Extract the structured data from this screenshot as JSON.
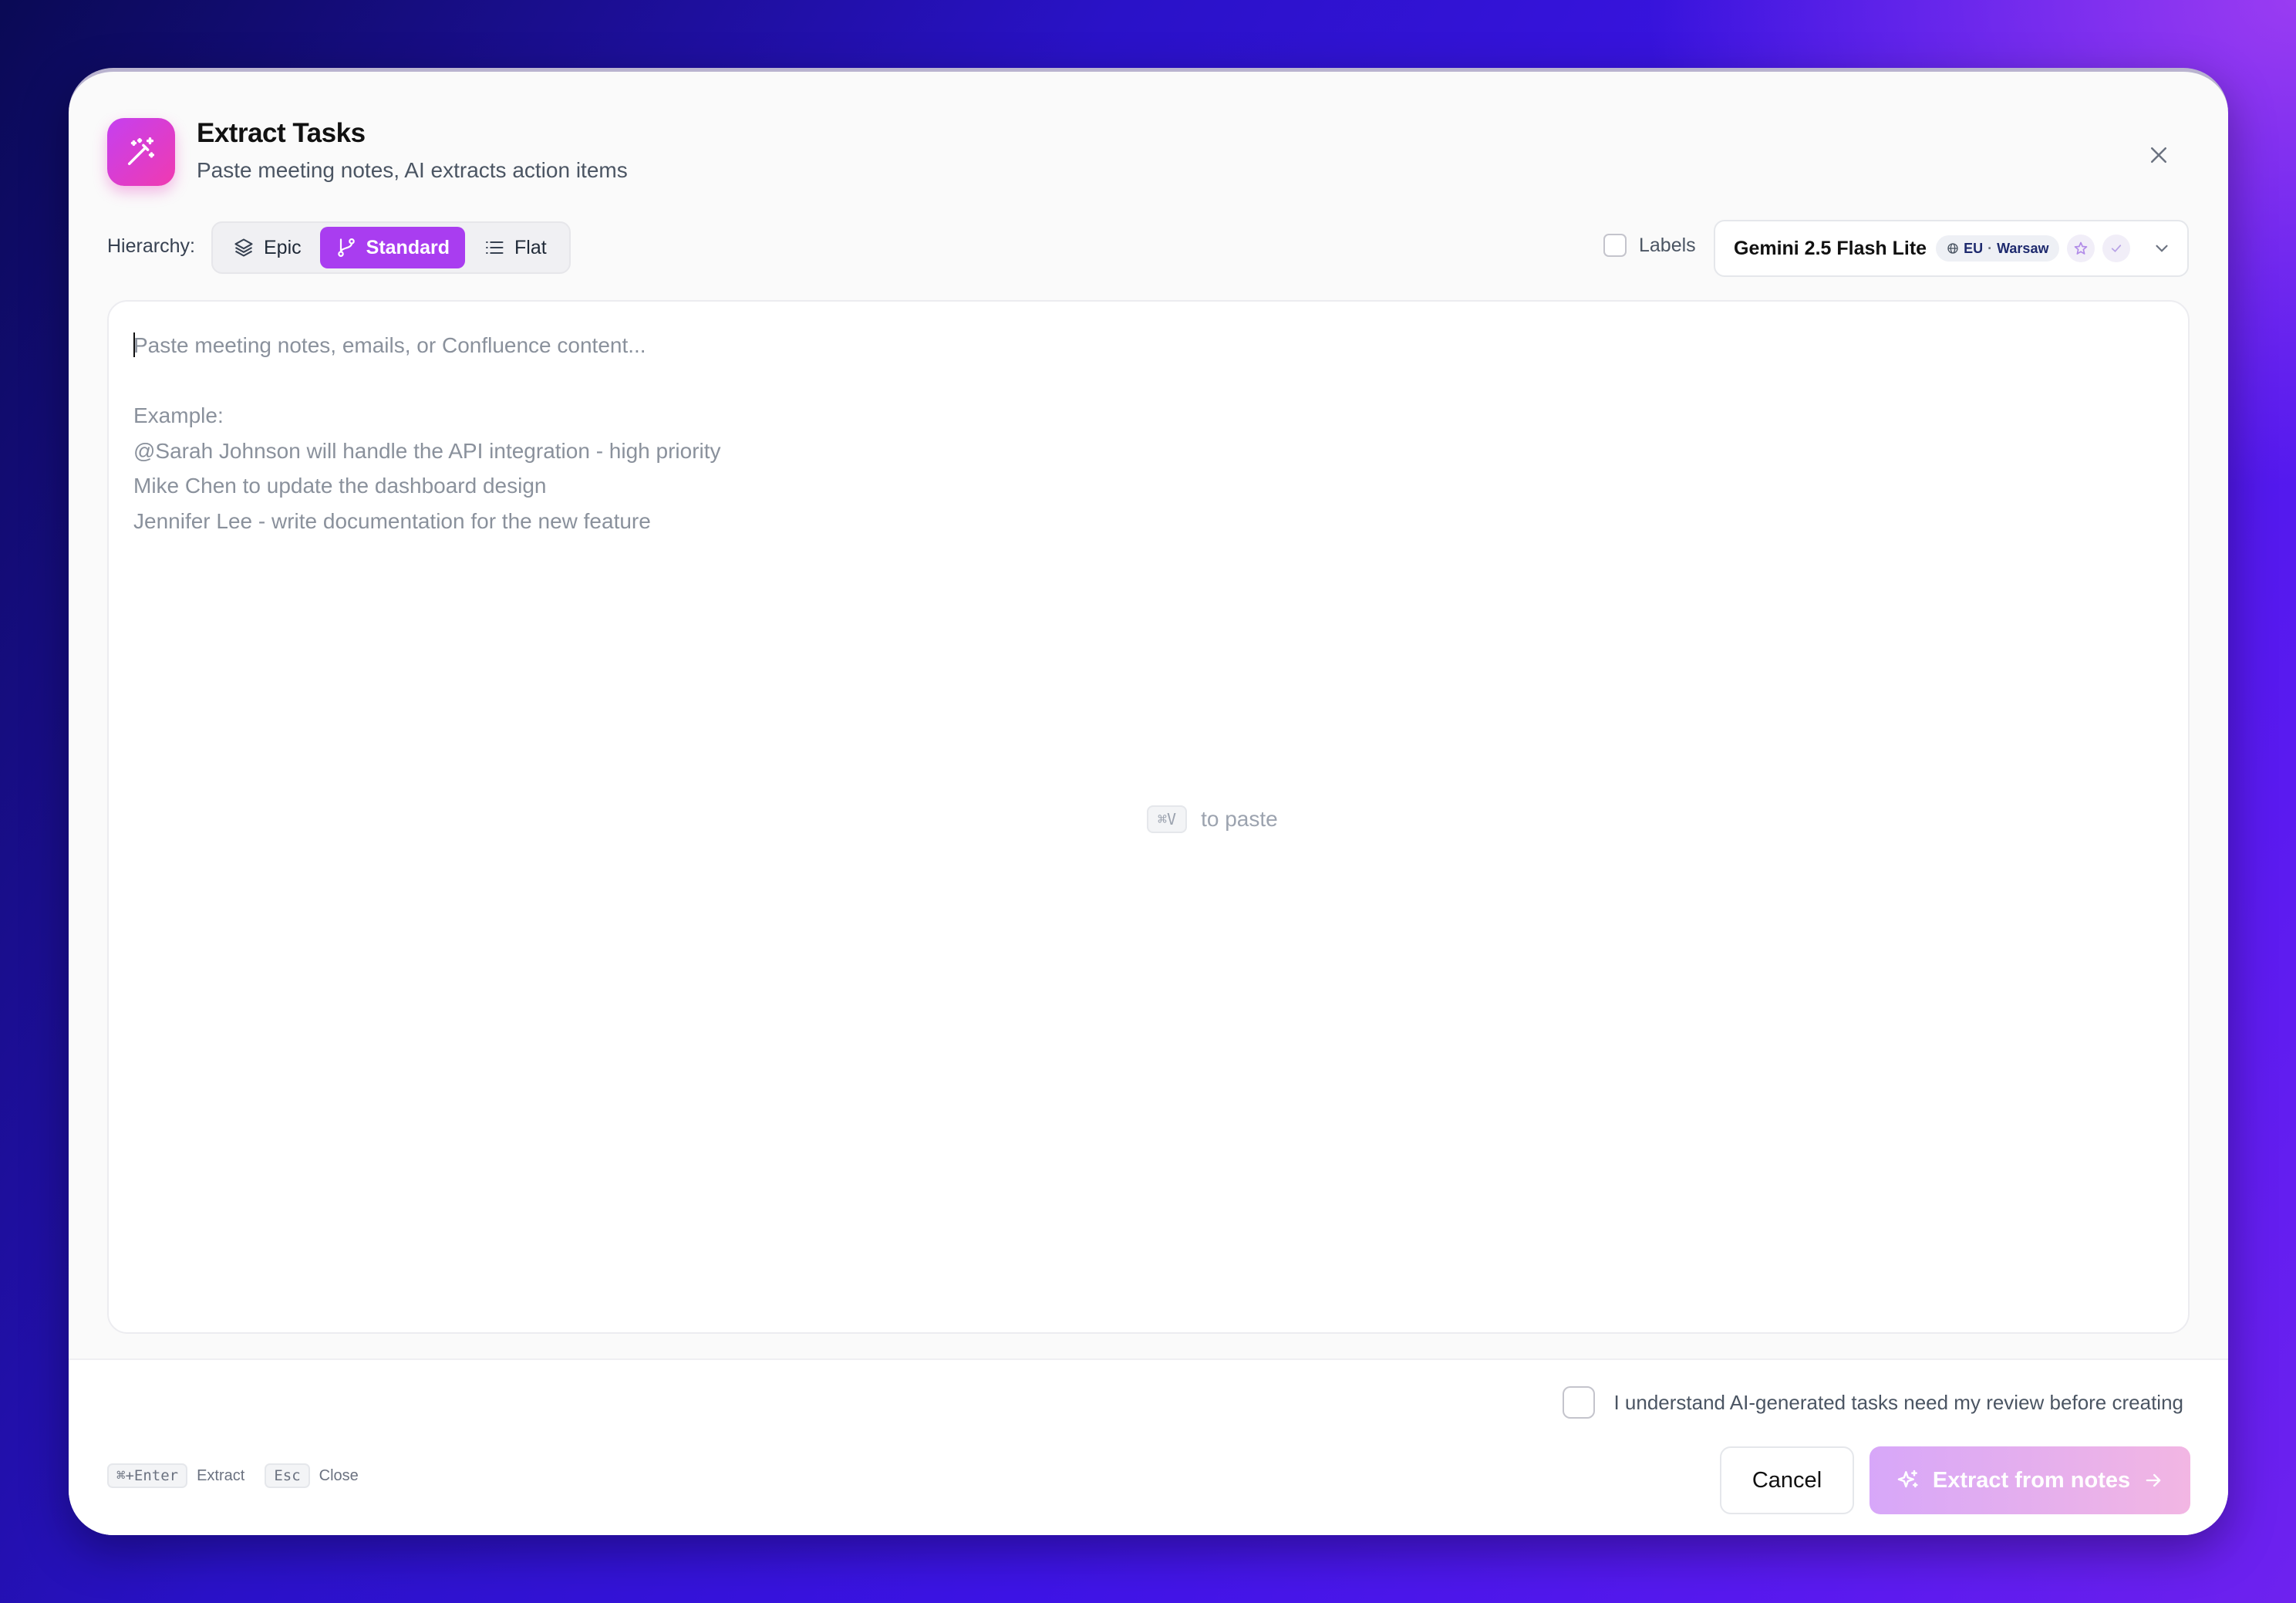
{
  "header": {
    "title": "Extract Tasks",
    "subtitle": "Paste meeting notes, AI extracts action items"
  },
  "hierarchy": {
    "label": "Hierarchy:",
    "options": [
      {
        "label": "Epic",
        "icon": "layers-icon",
        "active": false
      },
      {
        "label": "Standard",
        "icon": "git-branch-icon",
        "active": true
      },
      {
        "label": "Flat",
        "icon": "list-icon",
        "active": false
      }
    ]
  },
  "labels_toggle": {
    "label": "Labels",
    "checked": false
  },
  "model": {
    "name": "Gemini 2.5 Flash Lite",
    "region": "EU",
    "city": "Warsaw"
  },
  "textarea": {
    "placeholder": "Paste meeting notes, emails, or Confluence content...\n\nExample:\n@Sarah Johnson will handle the API integration - high priority\nMike Chen to update the dashboard design\nJennifer Lee - write documentation for the new feature",
    "value": ""
  },
  "paste_hint": {
    "key": "⌘V",
    "text": "to paste"
  },
  "consent": {
    "label": "I understand AI-generated tasks need my review before creating",
    "checked": false
  },
  "shortcuts": [
    {
      "key": "⌘+Enter",
      "label": "Extract"
    },
    {
      "key": "Esc",
      "label": "Close"
    }
  ],
  "buttons": {
    "cancel": "Cancel",
    "extract": "Extract from notes"
  },
  "colors": {
    "accent": "#a93df0",
    "icon_gradient_start": "#c540f0",
    "icon_gradient_end": "#f03ab0"
  }
}
